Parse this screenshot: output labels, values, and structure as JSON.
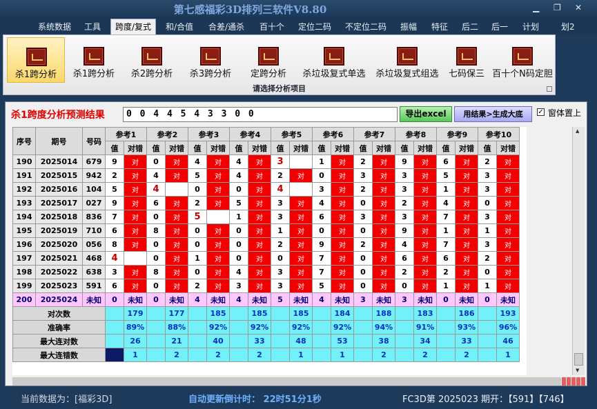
{
  "window": {
    "title": "第七感福彩3D排列三软件V8.80",
    "min": "▁",
    "max": "❐",
    "close": "✕"
  },
  "menu": [
    "系统数据",
    "工具",
    "跨度/复式",
    "和/合值",
    "合差/通杀",
    "百十个",
    "定位二码",
    "不定位二码",
    "振幅",
    "特征",
    "后二",
    "后一",
    "计划",
    "划2"
  ],
  "menu_active": 2,
  "ribbon": {
    "buttons": [
      "杀1跨分析",
      "杀1跨分析",
      "杀2跨分析",
      "杀3跨分析",
      "定跨分析",
      "杀垃圾复式单选",
      "杀垃圾复式组选",
      "七码保三",
      "百十个N码定胆"
    ],
    "active": 0,
    "caption": "请选择分析项目"
  },
  "panel": {
    "title": "杀1跨度分析预测结果",
    "result": "0 0 4 4 5 4 3 3 0 0",
    "export_label": "导出excel",
    "generate_label": "用结果>生成大底",
    "ontop_label": "窗体置上",
    "ontop_checked": "✓"
  },
  "table": {
    "h_seq": "序号",
    "h_issue": "期号",
    "h_code": "号码",
    "refs": [
      "参考1",
      "参考2",
      "参考3",
      "参考4",
      "参考5",
      "参考6",
      "参考7",
      "参考8",
      "参考9",
      "参考10"
    ],
    "sub_val": "值",
    "sub_res": "对错",
    "right_mark": "对",
    "rows": [
      {
        "seq": "190",
        "issue": "2025014",
        "code": "679",
        "vals": [
          "9",
          "0",
          "4",
          "4",
          "3",
          "1",
          "2",
          "9",
          "6",
          "2"
        ],
        "ok": [
          1,
          1,
          1,
          1,
          0,
          1,
          1,
          1,
          1,
          1
        ]
      },
      {
        "seq": "191",
        "issue": "2025015",
        "code": "942",
        "vals": [
          "2",
          "4",
          "5",
          "4",
          "2",
          "0",
          "3",
          "3",
          "5",
          "3"
        ],
        "ok": [
          1,
          1,
          1,
          1,
          1,
          1,
          1,
          1,
          1,
          1
        ]
      },
      {
        "seq": "192",
        "issue": "2025016",
        "code": "104",
        "vals": [
          "5",
          "4",
          "0",
          "0",
          "4",
          "3",
          "2",
          "3",
          "1",
          "3"
        ],
        "ok": [
          1,
          0,
          1,
          1,
          0,
          1,
          1,
          1,
          1,
          1
        ]
      },
      {
        "seq": "193",
        "issue": "2025017",
        "code": "027",
        "vals": [
          "9",
          "6",
          "2",
          "5",
          "3",
          "4",
          "0",
          "2",
          "4",
          "0"
        ],
        "ok": [
          1,
          1,
          1,
          1,
          1,
          1,
          1,
          1,
          1,
          1
        ]
      },
      {
        "seq": "194",
        "issue": "2025018",
        "code": "836",
        "vals": [
          "7",
          "0",
          "5",
          "1",
          "3",
          "6",
          "3",
          "3",
          "7",
          "3"
        ],
        "ok": [
          1,
          1,
          0,
          1,
          1,
          1,
          1,
          1,
          1,
          1
        ]
      },
      {
        "seq": "195",
        "issue": "2025019",
        "code": "710",
        "vals": [
          "6",
          "8",
          "0",
          "0",
          "1",
          "0",
          "0",
          "9",
          "1",
          "1"
        ],
        "ok": [
          1,
          1,
          1,
          1,
          1,
          1,
          1,
          1,
          1,
          1
        ]
      },
      {
        "seq": "196",
        "issue": "2025020",
        "code": "056",
        "vals": [
          "8",
          "0",
          "0",
          "0",
          "2",
          "9",
          "2",
          "4",
          "7",
          "3"
        ],
        "ok": [
          1,
          1,
          1,
          1,
          1,
          1,
          1,
          1,
          1,
          1
        ]
      },
      {
        "seq": "197",
        "issue": "2025021",
        "code": "468",
        "vals": [
          "4",
          "0",
          "1",
          "0",
          "0",
          "7",
          "0",
          "6",
          "6",
          "2"
        ],
        "ok": [
          0,
          1,
          1,
          1,
          1,
          1,
          1,
          1,
          1,
          1
        ]
      },
      {
        "seq": "198",
        "issue": "2025022",
        "code": "638",
        "vals": [
          "3",
          "8",
          "0",
          "4",
          "3",
          "7",
          "0",
          "2",
          "2",
          "0"
        ],
        "ok": [
          1,
          1,
          1,
          1,
          1,
          1,
          1,
          1,
          1,
          1
        ]
      },
      {
        "seq": "199",
        "issue": "2025023",
        "code": "591",
        "vals": [
          "6",
          "0",
          "2",
          "3",
          "3",
          "5",
          "0",
          "0",
          "1",
          "1"
        ],
        "ok": [
          1,
          1,
          1,
          1,
          1,
          1,
          1,
          1,
          1,
          1
        ]
      }
    ],
    "pending": {
      "seq": "200",
      "issue": "2025024",
      "code": "未知",
      "vals": [
        "0",
        "0",
        "4",
        "4",
        "5",
        "4",
        "3",
        "3",
        "0",
        "0"
      ],
      "res": "未知"
    },
    "stats": [
      {
        "label": "对次数",
        "vals": [
          "179",
          "177",
          "185",
          "185",
          "185",
          "184",
          "188",
          "183",
          "186",
          "193"
        ]
      },
      {
        "label": "准确率",
        "vals": [
          "89%",
          "88%",
          "92%",
          "92%",
          "92%",
          "92%",
          "94%",
          "91%",
          "93%",
          "96%"
        ]
      },
      {
        "label": "最大连对数",
        "vals": [
          "26",
          "21",
          "40",
          "33",
          "48",
          "53",
          "38",
          "34",
          "33",
          "46"
        ]
      },
      {
        "label": "最大连错数",
        "vals": [
          "1",
          "2",
          "2",
          "2",
          "1",
          "1",
          "2",
          "2",
          "2",
          "1"
        ]
      }
    ]
  },
  "status": {
    "current": "当前数据为：[福彩3D]",
    "countdown": "自动更新倒计时：  22时51分1秒",
    "draw": "FC3D第 2025023 期开：【591】【746】"
  },
  "colors": {
    "bg": "#1e3a5a",
    "wrong": "#f00000",
    "unknown": "#ffc6ff",
    "stat": "#74f0f8",
    "accent": "#e00000"
  }
}
